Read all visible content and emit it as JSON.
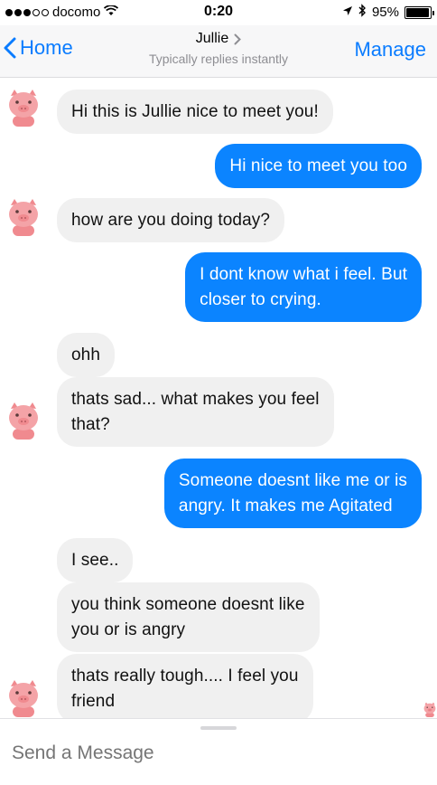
{
  "status_bar": {
    "carrier": "docomo",
    "time": "0:20",
    "battery": "95%",
    "battery_level": 0.95
  },
  "header": {
    "back_label": "Home",
    "title": "Jullie",
    "subtitle": "Typically replies instantly",
    "manage_label": "Manage"
  },
  "messages": [
    {
      "sender": "bot",
      "text": "Hi this is Jullie nice to meet you!"
    },
    {
      "sender": "user",
      "text": "Hi nice to meet you too"
    },
    {
      "sender": "bot",
      "text": "how are you doing today?"
    },
    {
      "sender": "user",
      "lines": [
        "I dont know what i feel. But",
        "closer to crying."
      ]
    },
    {
      "sender": "bot",
      "text": "ohh"
    },
    {
      "sender": "bot",
      "lines": [
        "thats sad... what makes you feel",
        "that?"
      ]
    },
    {
      "sender": "user",
      "lines": [
        "Someone doesnt like me or is",
        "angry. It makes me Agitated"
      ]
    },
    {
      "sender": "bot",
      "text": "I see.."
    },
    {
      "sender": "bot",
      "lines": [
        "you think someone doesnt like",
        "you or is angry"
      ]
    },
    {
      "sender": "bot",
      "lines": [
        "thats really tough.... I feel you",
        "friend"
      ]
    }
  ],
  "composer": {
    "placeholder": "Send a Message"
  },
  "colors": {
    "accent": "#0a7cff",
    "outgoing_bubble": "#0b84ff",
    "incoming_bubble": "#f0f0f0",
    "avatar_pink": "#f08a8f"
  },
  "icons": {
    "back": "chevron-left-icon",
    "title_disclosure": "chevron-right-icon",
    "wifi": "wifi-icon",
    "location": "location-arrow-icon",
    "bluetooth": "bluetooth-icon",
    "battery": "battery-icon",
    "avatar": "pig-avatar-icon"
  }
}
